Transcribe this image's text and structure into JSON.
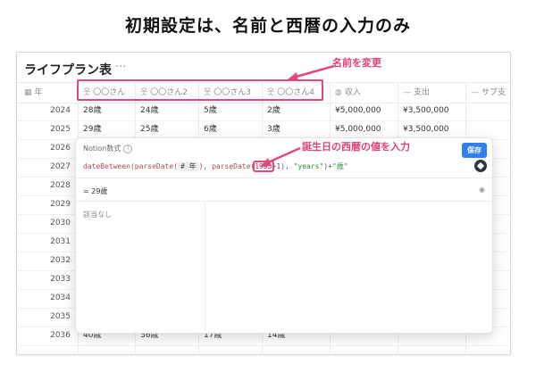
{
  "slide_title": "初期設定は、名前と西暦の入力のみ",
  "database": {
    "title": "ライフプラン表",
    "more": "···"
  },
  "columns": {
    "year": {
      "icon": "calendar-icon",
      "label": "年"
    },
    "persons": [
      {
        "icon": "person-icon",
        "label": "〇〇さん"
      },
      {
        "icon": "person-icon",
        "label": "〇〇さん2"
      },
      {
        "icon": "person-icon",
        "label": "〇〇さん3"
      },
      {
        "icon": "person-icon",
        "label": "〇〇さん4"
      }
    ],
    "income": {
      "icon": "formula-icon",
      "label": "収入"
    },
    "expense": {
      "icon": "dash-icon",
      "label": "支出"
    },
    "side": {
      "icon": "dash-icon",
      "label": "サブ支"
    }
  },
  "rows": [
    {
      "year": "2024",
      "p1": "28歳",
      "p2": "24歳",
      "p3": "5歳",
      "p4": "2歳",
      "income": "¥5,000,000",
      "expense": "¥3,500,000"
    },
    {
      "year": "2025",
      "p1": "29歳",
      "p2": "25歳",
      "p3": "6歳",
      "p4": "3歳",
      "income": "¥5,000,000",
      "expense": "¥3,500,000"
    },
    {
      "year": "2026"
    },
    {
      "year": "2027"
    },
    {
      "year": "2028"
    },
    {
      "year": "2029"
    },
    {
      "year": "2030"
    },
    {
      "year": "2031"
    },
    {
      "year": "2032"
    },
    {
      "year": "2033"
    },
    {
      "year": "2034"
    },
    {
      "year": "2035"
    },
    {
      "year": "2036",
      "p1": "40歳",
      "p2": "36歳",
      "p3": "17歳",
      "p4": "14歳"
    }
  ],
  "callouts": {
    "rename": "名前を変更",
    "birth_year": "誕生日の西暦の値を入力"
  },
  "formula_panel": {
    "label": "Notion数式",
    "help_icon": "?",
    "save_label": "保存",
    "formula": {
      "part1": "dateBetween(",
      "part2": "parseDate(",
      "token": "# 年",
      "part3": "), ",
      "part4": "parseDate(",
      "highlight": "1995",
      "part5": "+1), ",
      "string1": "\"years\"",
      "part6": ")+",
      "string2": "\"歳\""
    },
    "result": "= 29歳",
    "empty_label": "該当なし"
  },
  "colors": {
    "accent_pink": "#e04a77",
    "save_blue": "#2f80ed"
  }
}
